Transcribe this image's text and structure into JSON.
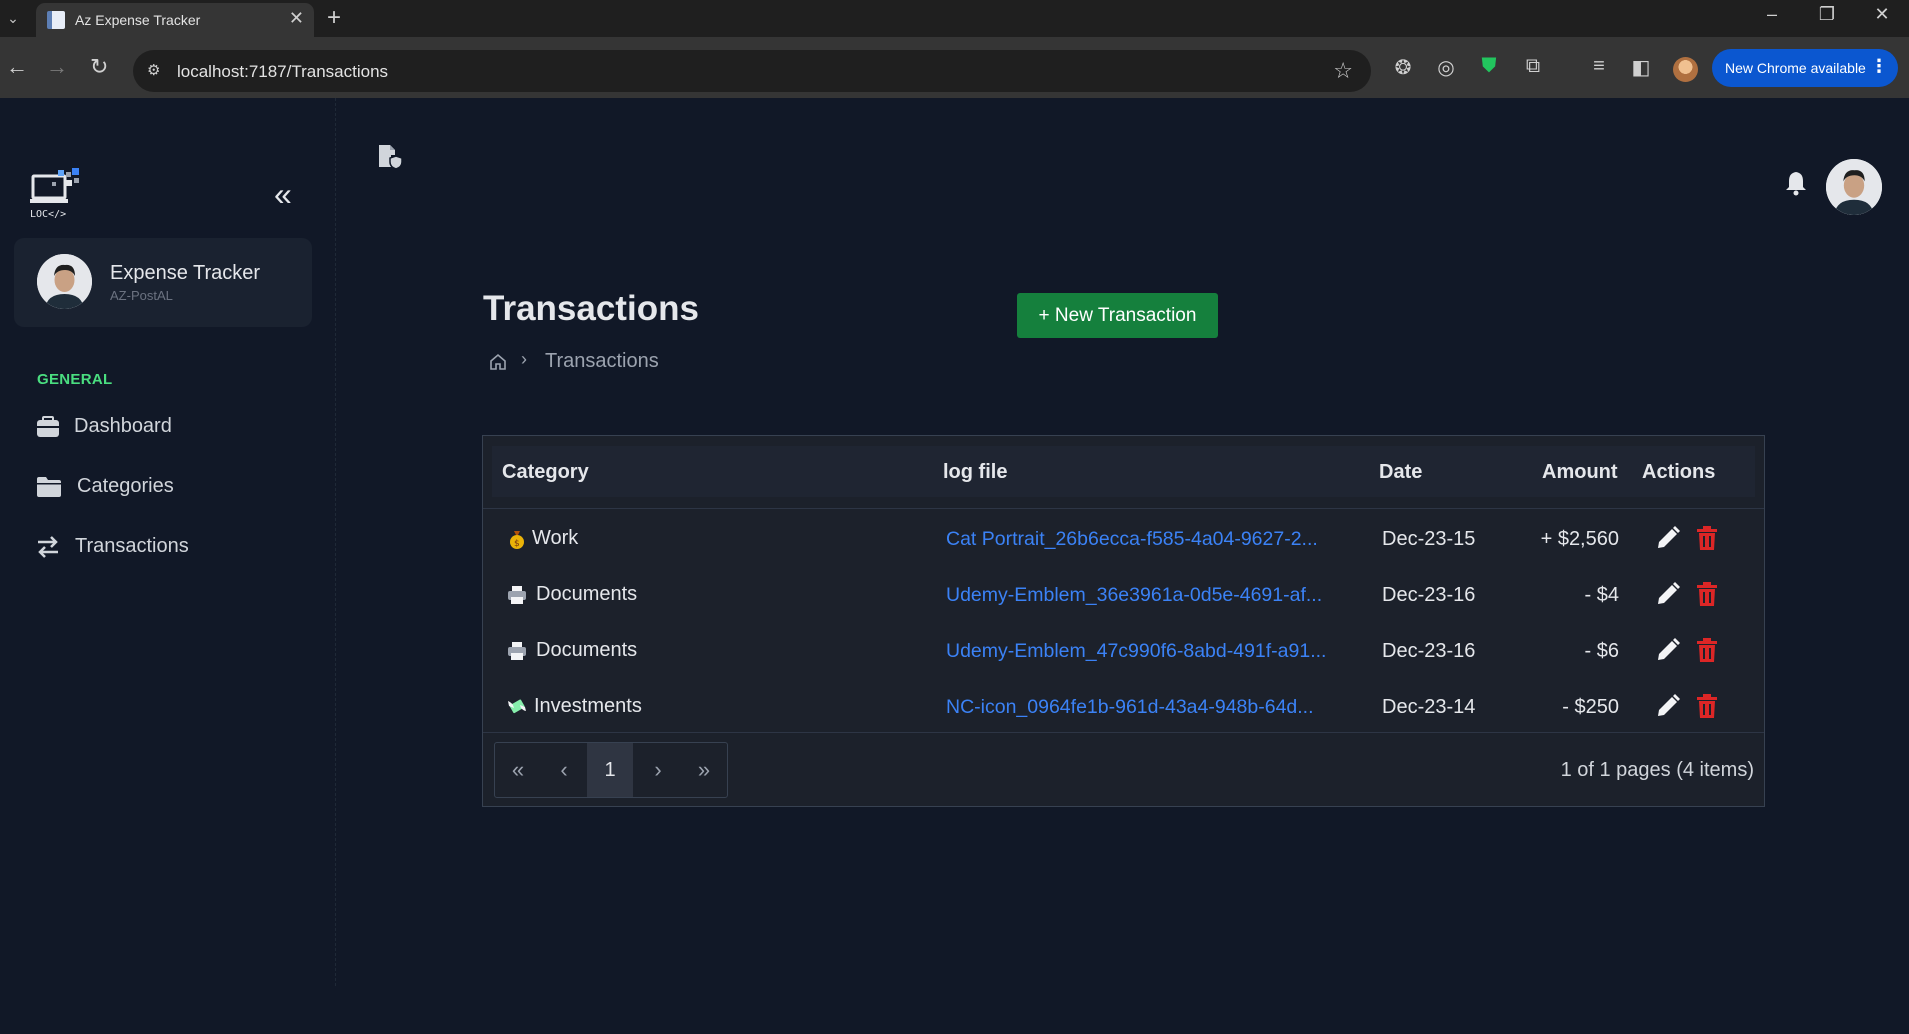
{
  "browser": {
    "tab_title": "Az Expense Tracker",
    "url": "localhost:7187/Transactions",
    "update_label": "New Chrome available"
  },
  "sidebar": {
    "logo_text": "LOC</>",
    "user_name": "Expense Tracker",
    "user_sub": "AZ-PostAL",
    "section": "GENERAL",
    "items": [
      {
        "label": "Dashboard",
        "icon": "dashboard-icon"
      },
      {
        "label": "Categories",
        "icon": "folder-icon"
      },
      {
        "label": "Transactions",
        "icon": "transfer-icon"
      }
    ]
  },
  "page": {
    "title": "Transactions",
    "new_button": "+ New Transaction",
    "breadcrumb_current": "Transactions"
  },
  "grid": {
    "columns": [
      "Category",
      "log file",
      "Date",
      "Amount",
      "Actions"
    ],
    "rows": [
      {
        "icon": "money-bag-icon",
        "category": "Work",
        "file": "Cat Portrait_26b6ecca-f585-4a04-9627-2...",
        "date": "Dec-23-15",
        "amount": "+ $2,560"
      },
      {
        "icon": "printer-icon",
        "category": "Documents",
        "file": "Udemy-Emblem_36e3961a-0d5e-4691-af...",
        "date": "Dec-23-16",
        "amount": "- $4"
      },
      {
        "icon": "printer-icon",
        "category": "Documents",
        "file": "Udemy-Emblem_47c990f6-8abd-491f-a91...",
        "date": "Dec-23-16",
        "amount": "- $6"
      },
      {
        "icon": "money-wings-icon",
        "category": "Investments",
        "file": "NC-icon_0964fe1b-961d-43a4-948b-64d...",
        "date": "Dec-23-14",
        "amount": "- $250"
      }
    ],
    "pager": {
      "current_page": "1",
      "info": "1 of 1 pages (4 items)"
    }
  },
  "colors": {
    "accent_green": "#15803d",
    "link_blue": "#3b82f6",
    "delete_red": "#dc2626",
    "section_green": "#4ade80"
  }
}
